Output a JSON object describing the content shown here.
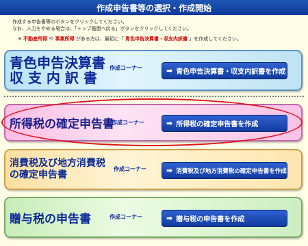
{
  "header": {
    "title": "作成申告書等の選択・作成開始"
  },
  "intro": {
    "line1": "作成する申告書等のボタンをクリックしてください。",
    "line2": "なお、入力をやめる場合は、「トップ画面へ戻る」ボタンをクリックしてください。"
  },
  "note": {
    "prefix": "※",
    "item1": "不動産所得",
    "middle1": "や",
    "item2": "事業所得",
    "middle2": "がある方は、最初に「",
    "item3": "青色申告決算書・収支内訳書",
    "suffix": "」を作成してください。"
  },
  "cards": [
    {
      "title_line1": "青色申告決算書",
      "title_line2": "収 支 内 訳 書",
      "corner": "作成コーナー",
      "button": "青色申告決算書・収支内訳書を作成"
    },
    {
      "title_line1": "所得税の確定申告書",
      "corner": "作成コーナー",
      "button": "所得税の確定申告書を作成"
    },
    {
      "title_line1": "消費税及び地方消費税",
      "title_line2": "の確定申告書",
      "corner": "作成コーナー",
      "button": "消費税及び地方消費税の確定申告書を作成"
    },
    {
      "title_line1": "贈与税の申告書",
      "corner": "作成コーナー",
      "button": "贈与税の申告書を作成"
    }
  ],
  "icons": {
    "button_arrow": "arrow-right-icon"
  },
  "colors": {
    "header": "#1a4aa8",
    "highlight_oval": "#e0141e",
    "title": "#0c2a9a"
  }
}
